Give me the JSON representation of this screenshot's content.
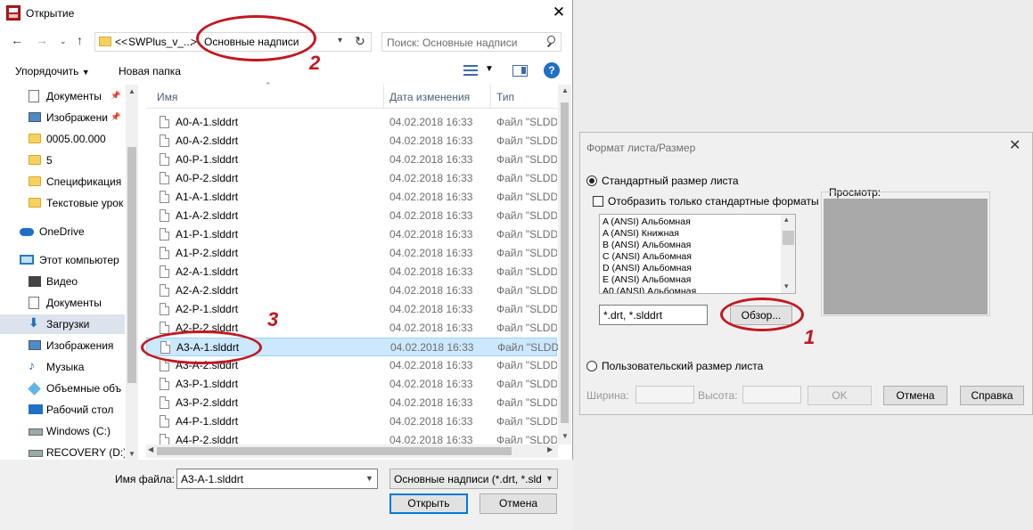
{
  "open_dialog": {
    "title": "Открытие",
    "address": {
      "prefix": "<<",
      "folder1": "SWPlus_v_...",
      "separator": ">",
      "folder2": "Основные надписи"
    },
    "search": {
      "placeholder": "Поиск: Основные надписи"
    },
    "toolbar": {
      "organize": "Упорядочить",
      "new_folder": "Новая папка"
    },
    "nav": [
      {
        "label": "Документы",
        "icon": "documents-icon",
        "pinned": true
      },
      {
        "label": "Изображени",
        "icon": "pictures-icon",
        "pinned": true
      },
      {
        "label": "0005.00.000",
        "icon": "folder-icon"
      },
      {
        "label": "5",
        "icon": "folder-icon"
      },
      {
        "label": "Спецификация",
        "icon": "folder-icon"
      },
      {
        "label": "Текстовые урок",
        "icon": "folder-icon"
      },
      {
        "label": "OneDrive",
        "icon": "onedrive-icon",
        "root": true
      },
      {
        "label": "Этот компьютер",
        "icon": "computer-icon",
        "root": true
      },
      {
        "label": "Видео",
        "icon": "video-icon"
      },
      {
        "label": "Документы",
        "icon": "documents-icon"
      },
      {
        "label": "Загрузки",
        "icon": "downloads-icon",
        "selected": true
      },
      {
        "label": "Изображения",
        "icon": "pictures-icon"
      },
      {
        "label": "Музыка",
        "icon": "music-icon"
      },
      {
        "label": "Объемные объ",
        "icon": "3d-objects-icon"
      },
      {
        "label": "Рабочий стол",
        "icon": "desktop-icon"
      },
      {
        "label": "Windows (C:)",
        "icon": "drive-icon"
      },
      {
        "label": "RECOVERY (D:)",
        "icon": "drive-icon"
      }
    ],
    "columns": {
      "name": "Имя",
      "date": "Дата изменения",
      "type": "Тип"
    },
    "files": [
      {
        "name": "A0-A-1.slddrt",
        "date": "04.02.2018 16:33",
        "type": "Файл \"SLDDRT\""
      },
      {
        "name": "A0-A-2.slddrt",
        "date": "04.02.2018 16:33",
        "type": "Файл \"SLDDRT\""
      },
      {
        "name": "A0-P-1.slddrt",
        "date": "04.02.2018 16:33",
        "type": "Файл \"SLDDRT\""
      },
      {
        "name": "A0-P-2.slddrt",
        "date": "04.02.2018 16:33",
        "type": "Файл \"SLDDRT\""
      },
      {
        "name": "A1-A-1.slddrt",
        "date": "04.02.2018 16:33",
        "type": "Файл \"SLDDRT\""
      },
      {
        "name": "A1-A-2.slddrt",
        "date": "04.02.2018 16:33",
        "type": "Файл \"SLDDRT\""
      },
      {
        "name": "A1-P-1.slddrt",
        "date": "04.02.2018 16:33",
        "type": "Файл \"SLDDRT\""
      },
      {
        "name": "A1-P-2.slddrt",
        "date": "04.02.2018 16:33",
        "type": "Файл \"SLDDRT\""
      },
      {
        "name": "A2-A-1.slddrt",
        "date": "04.02.2018 16:33",
        "type": "Файл \"SLDDRT\""
      },
      {
        "name": "A2-A-2.slddrt",
        "date": "04.02.2018 16:33",
        "type": "Файл \"SLDDRT\""
      },
      {
        "name": "A2-P-1.slddrt",
        "date": "04.02.2018 16:33",
        "type": "Файл \"SLDDRT\""
      },
      {
        "name": "A2-P-2.slddrt",
        "date": "04.02.2018 16:33",
        "type": "Файл \"SLDDRT\""
      },
      {
        "name": "A3-A-1.slddrt",
        "date": "04.02.2018 16:33",
        "type": "Файл \"SLDDRT\"",
        "selected": true
      },
      {
        "name": "A3-A-2.slddrt",
        "date": "04.02.2018 16:33",
        "type": "Файл \"SLDDRT\""
      },
      {
        "name": "A3-P-1.slddrt",
        "date": "04.02.2018 16:33",
        "type": "Файл \"SLDDRT\""
      },
      {
        "name": "A3-P-2.slddrt",
        "date": "04.02.2018 16:33",
        "type": "Файл \"SLDDRT\""
      },
      {
        "name": "A4-P-1.slddrt",
        "date": "04.02.2018 16:33",
        "type": "Файл \"SLDDRT\""
      },
      {
        "name": "A4-P-2.slddrt",
        "date": "04.02.2018 16:33",
        "type": "Файл \"SLDDRT\""
      }
    ],
    "filename_label": "Имя файла:",
    "filename_value": "A3-A-1.slddrt",
    "filetype_value": "Основные надписи (*.drt, *.sld",
    "open_button": "Открыть",
    "cancel_button": "Отмена"
  },
  "format_dialog": {
    "title": "Формат листа/Размер",
    "standard_radio": "Стандартный размер листа",
    "only_standard_checkbox": "Отобразить только стандартные форматы",
    "formats": [
      "A (ANSI) Альбомная",
      "A (ANSI) Книжная",
      "B (ANSI) Альбомная",
      "C (ANSI) Альбомная",
      "D (ANSI) Альбомная",
      "E (ANSI) Альбомная",
      "A0 (ANSI) Альбомная"
    ],
    "file_field": "*.drt, *.slddrt",
    "browse_button": "Обзор...",
    "preview_label": "Просмотр:",
    "custom_radio": "Пользовательский размер листа",
    "width_label": "Ширина:",
    "height_label": "Высота:",
    "ok_button": "OK",
    "cancel_button": "Отмена",
    "help_button": "Справка"
  },
  "annotations": {
    "marker_1": "1",
    "marker_2": "2",
    "marker_3": "3",
    "color": "#c3171f"
  }
}
